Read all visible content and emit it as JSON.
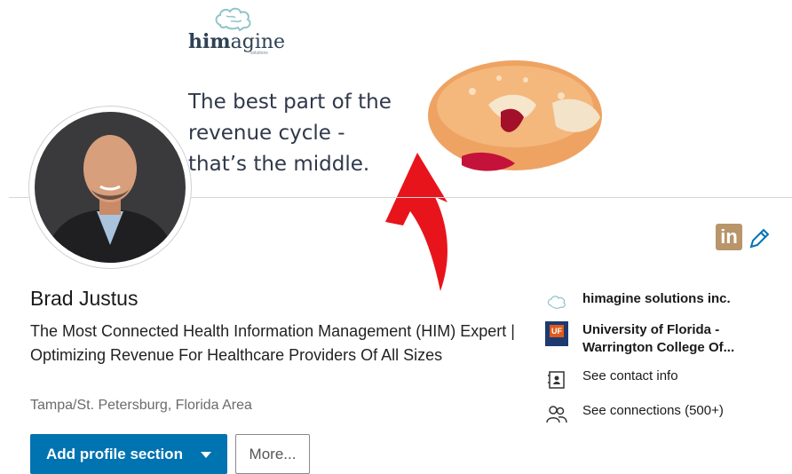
{
  "banner": {
    "logo_prefix": "him",
    "logo_suffix": "agine",
    "logo_sub": "solutions",
    "tagline_lines": [
      "The best part of the",
      "revenue cycle -",
      "that’s the middle."
    ]
  },
  "profile": {
    "name": "Brad Justus",
    "headline": "The Most Connected Health Information Management (HIM) Expert | Optimizing Revenue For Healthcare Providers Of All Sizes",
    "location": "Tampa/St. Petersburg, Florida Area"
  },
  "actions": {
    "add_section_label": "Add profile section",
    "more_label": "More..."
  },
  "sidebar": {
    "company": "himagine solutions inc.",
    "school_line1": "University of Florida -",
    "school_line2": "Warrington College Of...",
    "contact": "See contact info",
    "connections": "See connections (500+)"
  },
  "icons": {
    "linkedin": "in",
    "school_badge": "UF"
  },
  "colors": {
    "accent": "#0073b1",
    "linkedin_badge": "#b8956a",
    "arrow": "#e8141c"
  }
}
